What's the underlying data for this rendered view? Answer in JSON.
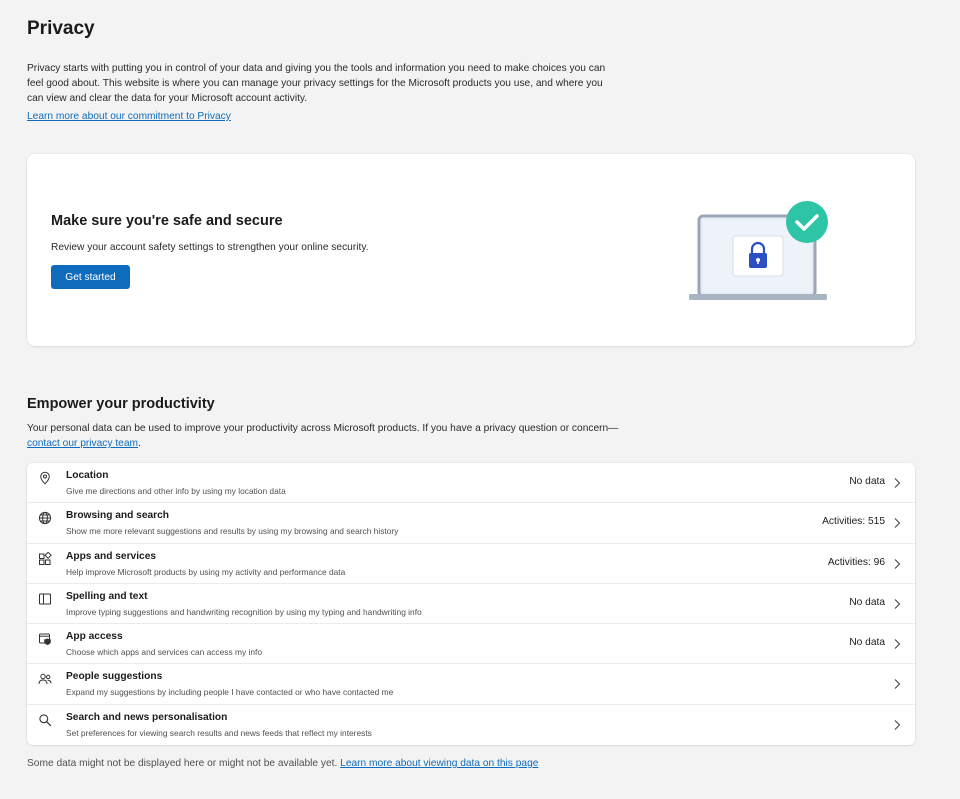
{
  "header": {
    "title": "Privacy",
    "intro": "Privacy starts with putting you in control of your data and giving you the tools and information you need to make choices you can feel good about. This website is where you can manage your privacy settings for the Microsoft products you use, and where you can view and clear the data for your Microsoft account activity.",
    "learn_more": "Learn more about our commitment to Privacy"
  },
  "security_card": {
    "title": "Make sure you're safe and secure",
    "description": "Review your account safety settings to strengthen your online security.",
    "button": "Get started"
  },
  "productivity": {
    "title": "Empower your productivity",
    "desc_prefix": "Your personal data can be used to improve your productivity across Microsoft products. If you have a privacy question or concern—",
    "desc_link": "contact our privacy team",
    "desc_suffix": ".",
    "items": [
      {
        "icon": "location-pin-icon",
        "title": "Location",
        "subtitle": "Give me directions and other info by using my location data",
        "status": "No data"
      },
      {
        "icon": "globe-icon",
        "title": "Browsing and search",
        "subtitle": "Show me more relevant suggestions and results by using my browsing and search history",
        "status": "Activities: 515"
      },
      {
        "icon": "apps-grid-icon",
        "title": "Apps and services",
        "subtitle": "Help improve Microsoft products by using my activity and performance data",
        "status": "Activities: 96"
      },
      {
        "icon": "book-icon",
        "title": "Spelling and text",
        "subtitle": "Improve typing suggestions and handwriting recognition by using my typing and handwriting info",
        "status": "No data"
      },
      {
        "icon": "window-shield-icon",
        "title": "App access",
        "subtitle": "Choose which apps and services can access my info",
        "status": "No data"
      },
      {
        "icon": "people-icon",
        "title": "People suggestions",
        "subtitle": "Expand my suggestions by including people I have contacted or who have contacted me",
        "status": ""
      },
      {
        "icon": "search-icon",
        "title": "Search and news personalisation",
        "subtitle": "Set preferences for viewing search results and news feeds that reflect my interests",
        "status": ""
      }
    ]
  },
  "footer": {
    "text": "Some data might not be displayed here or might not be available yet. ",
    "link": "Learn more about viewing data on this page"
  },
  "colors": {
    "accent": "#0f6cbd",
    "background": "#f3f3f3",
    "check_badge": "#2ec4a6"
  }
}
